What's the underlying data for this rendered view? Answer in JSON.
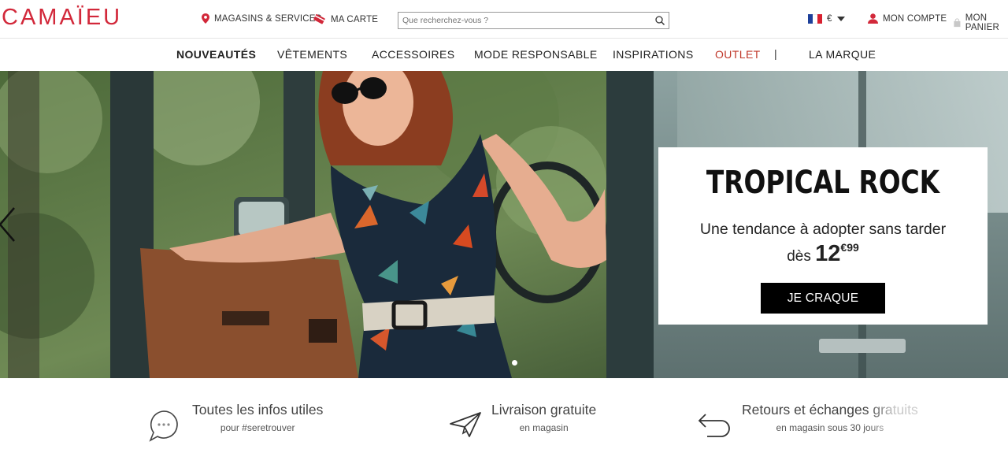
{
  "header": {
    "logo": "CAMAÏEU",
    "stores_label": "MAGASINS & SERVICES",
    "card_label": "MA CARTE",
    "search_placeholder": "Que recherchez-vous ?",
    "currency": "€",
    "account_label": "MON COMPTE",
    "cart_label": "MON PANIER"
  },
  "nav": {
    "items": [
      {
        "label": "NOUVEAUTÉS"
      },
      {
        "label": "VÊTEMENTS"
      },
      {
        "label": "ACCESSOIRES"
      },
      {
        "label": "MODE RESPONSABLE"
      },
      {
        "label": "INSPIRATIONS"
      },
      {
        "label": "OUTLET"
      },
      {
        "label": "LA MARQUE"
      }
    ],
    "separator": "|"
  },
  "hero": {
    "title": "TROPICAL ROCK",
    "subtitle": "Une tendance à adopter sans tarder",
    "price_prefix": "dès",
    "price_int": "12",
    "price_dec": "€99",
    "cta": "JE CRAQUE"
  },
  "info": [
    {
      "title": "Toutes les infos utiles",
      "sub": "pour #seretrouver",
      "icon": "chat-bubble-icon"
    },
    {
      "title": "Livraison gratuite",
      "sub": "en magasin",
      "icon": "paper-plane-icon"
    },
    {
      "title": "Retours et échanges gratuits",
      "sub": "en magasin sous 30 jours",
      "icon": "return-arrow-icon"
    }
  ],
  "colors": {
    "brand": "#d2283a",
    "outlet": "#c0392b",
    "button": "#000000"
  }
}
